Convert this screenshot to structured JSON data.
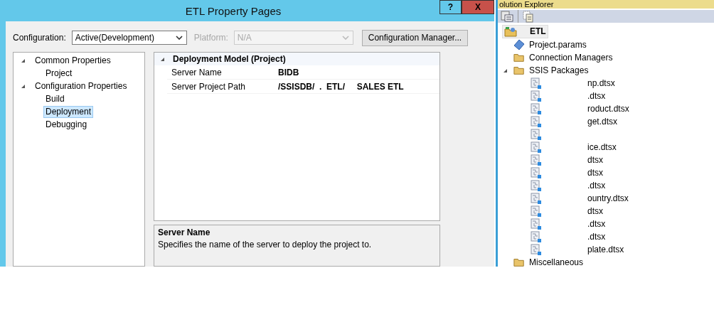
{
  "dialog": {
    "title": "ETL Property Pages",
    "help_button": "?",
    "close_button": "X",
    "configuration": {
      "label": "Configuration:",
      "value": "Active(Development)"
    },
    "platform": {
      "label": "Platform:",
      "value": "N/A",
      "disabled": true
    },
    "config_manager_button": "Configuration Manager...",
    "nav_tree": [
      {
        "label": "Common Properties",
        "expanded": true,
        "children": [
          {
            "label": "Project",
            "selected": false
          }
        ]
      },
      {
        "label": "Configuration Properties",
        "expanded": true,
        "children": [
          {
            "label": "Build",
            "selected": false
          },
          {
            "label": "Deployment",
            "selected": true
          },
          {
            "label": "Debugging",
            "selected": false
          }
        ]
      }
    ],
    "property_grid": {
      "category": "Deployment Model (Project)",
      "expanded": true,
      "rows": [
        {
          "name": "Server Name",
          "value": "BIDB"
        },
        {
          "name": "Server Project Path",
          "value": "/SSISDB/  .  ETL/     SALES ETL"
        }
      ]
    },
    "description": {
      "title": "Server Name",
      "text": "Specifies the name of the server to deploy the project to."
    }
  },
  "solution_explorer": {
    "title": "olution Explorer",
    "tree": {
      "label": "ETL",
      "children": [
        {
          "kind": "params",
          "label": "Project.params"
        },
        {
          "kind": "folder",
          "label": "Connection Managers"
        },
        {
          "kind": "folder",
          "label": "SSIS Packages",
          "expanded": true,
          "children": [
            {
              "kind": "package",
              "label": "np.dtsx"
            },
            {
              "kind": "package",
              "label": ".dtsx"
            },
            {
              "kind": "package",
              "label": "roduct.dtsx"
            },
            {
              "kind": "package",
              "label": "get.dtsx"
            },
            {
              "kind": "package"
            },
            {
              "kind": "package",
              "label": "ice.dtsx"
            },
            {
              "kind": "package",
              "label": "dtsx"
            },
            {
              "kind": "package",
              "label": "dtsx"
            },
            {
              "kind": "package",
              "label": ".dtsx"
            },
            {
              "kind": "package",
              "label": "ountry.dtsx"
            },
            {
              "kind": "package",
              "label": "dtsx"
            },
            {
              "kind": "package",
              "label": ".dtsx"
            },
            {
              "kind": "package",
              "label": ".dtsx"
            },
            {
              "kind": "package",
              "label": "plate.dtsx"
            }
          ]
        },
        {
          "kind": "folder",
          "label": "Miscellaneous"
        }
      ]
    }
  }
}
